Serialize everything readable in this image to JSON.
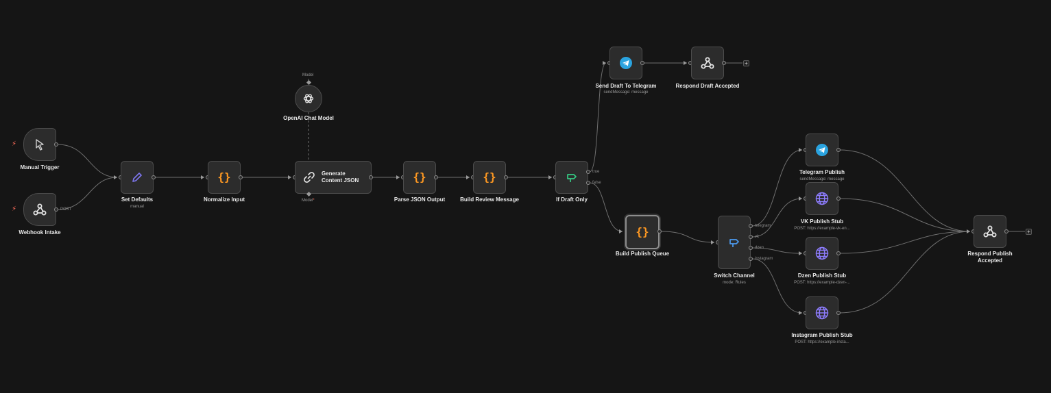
{
  "nodes": {
    "manual_trigger": {
      "label": "Manual Trigger",
      "icon": "cursor-icon"
    },
    "webhook_intake": {
      "label": "Webhook Intake",
      "icon": "webhook-icon",
      "output_label": "POST"
    },
    "set_defaults": {
      "label": "Set Defaults",
      "subtitle": "manual",
      "icon": "pencil-icon"
    },
    "normalize_input": {
      "label": "Normalize Input",
      "icon": "code-braces-icon"
    },
    "openai_chat_model": {
      "label": "OpenAI Chat Model",
      "icon": "openai-icon",
      "top_label": "Model"
    },
    "generate_content_json": {
      "label": "Generate\nContent JSON",
      "icon": "chain-link-icon",
      "model_label": "Model",
      "model_required": "*"
    },
    "parse_json_output": {
      "label": "Parse JSON Output",
      "icon": "code-braces-icon"
    },
    "build_review_message": {
      "label": "Build Review Message",
      "icon": "code-braces-icon"
    },
    "if_draft_only": {
      "label": "If Draft Only",
      "icon": "if-branch-icon",
      "true_label": "true",
      "false_label": "false"
    },
    "send_draft_to_telegram": {
      "label": "Send Draft To Telegram",
      "subtitle": "sendMessage: message",
      "icon": "telegram-icon"
    },
    "respond_draft_accepted": {
      "label": "Respond Draft Accepted",
      "icon": "webhook-icon"
    },
    "build_publish_queue": {
      "label": "Build Publish Queue",
      "icon": "code-braces-icon"
    },
    "switch_channel": {
      "label": "Switch Channel",
      "subtitle": "mode: Rules",
      "icon": "switch-icon",
      "outputs": [
        "telegram",
        "vk",
        "dzen",
        "instagram"
      ]
    },
    "telegram_publish": {
      "label": "Telegram Publish",
      "subtitle": "sendMessage: message",
      "icon": "telegram-icon"
    },
    "vk_publish_stub": {
      "label": "VK Publish Stub",
      "subtitle": "POST: https://example-vk-en...",
      "icon": "globe-icon"
    },
    "dzen_publish_stub": {
      "label": "Dzen Publish Stub",
      "subtitle": "POST: https://example-dzen-...",
      "icon": "globe-icon"
    },
    "instagram_publish_stub": {
      "label": "Instagram Publish Stub",
      "subtitle": "POST: https://example-insta...",
      "icon": "globe-icon"
    },
    "respond_publish_accepted": {
      "label": "Respond Publish\nAccepted",
      "icon": "webhook-icon"
    }
  },
  "add_button_symbol": "+",
  "trigger_marker": "⚡",
  "colors": {
    "canvas": "#151515",
    "node_bg": "#2c2c2c",
    "node_border": "#4c4c4c",
    "edge": "#6f6f6f",
    "code_orange": "#ff9922",
    "telegram_blue": "#2aa3df",
    "globe_purple": "#8e7dff",
    "if_green": "#35c983",
    "switch_blue": "#4c9bf0",
    "pencil_purple": "#7f77f2",
    "trigger_red": "#ff6d5a"
  }
}
